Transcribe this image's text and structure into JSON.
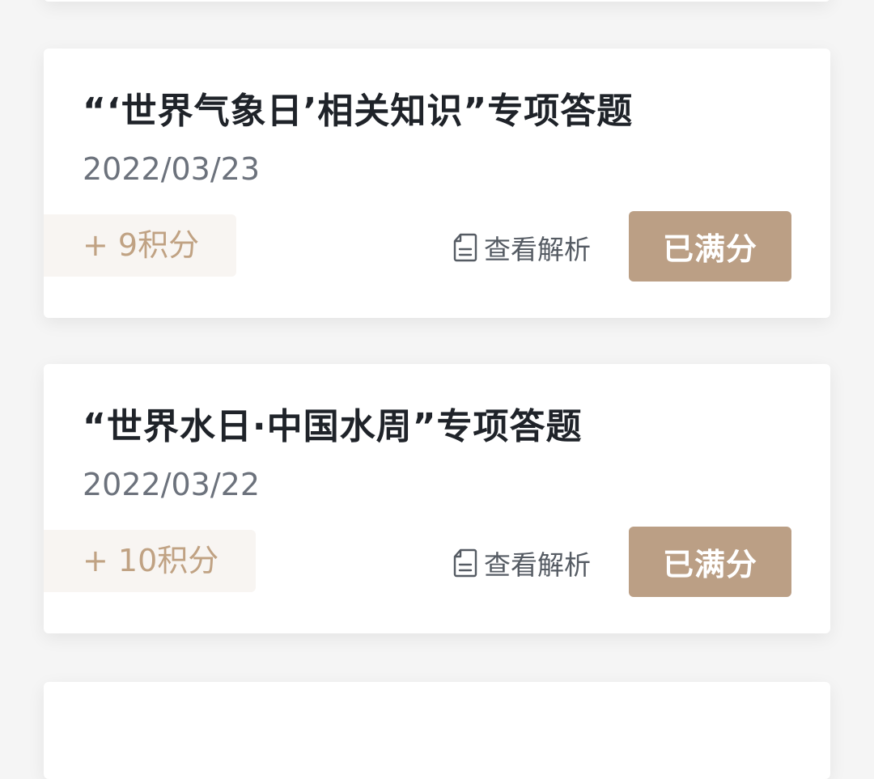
{
  "quizzes": [
    {
      "title": "“‘世界气象日’相关知识”专项答题",
      "date": "2022/03/23",
      "points": "+ 9积分",
      "review_label": "查看解析",
      "status_label": "已满分"
    },
    {
      "title": "“世界水日·中国水周”专项答题",
      "date": "2022/03/22",
      "points": "+ 10积分",
      "review_label": "查看解析",
      "status_label": "已满分"
    }
  ],
  "colors": {
    "background": "#f5f5f5",
    "card": "#ffffff",
    "title": "#1f2329",
    "date": "#6c727c",
    "points_bg": "#f8f5f2",
    "points_text": "#c0a283",
    "button_bg": "#bb9f85",
    "button_text": "#ffffff"
  },
  "icons": {
    "review": "document-icon"
  }
}
